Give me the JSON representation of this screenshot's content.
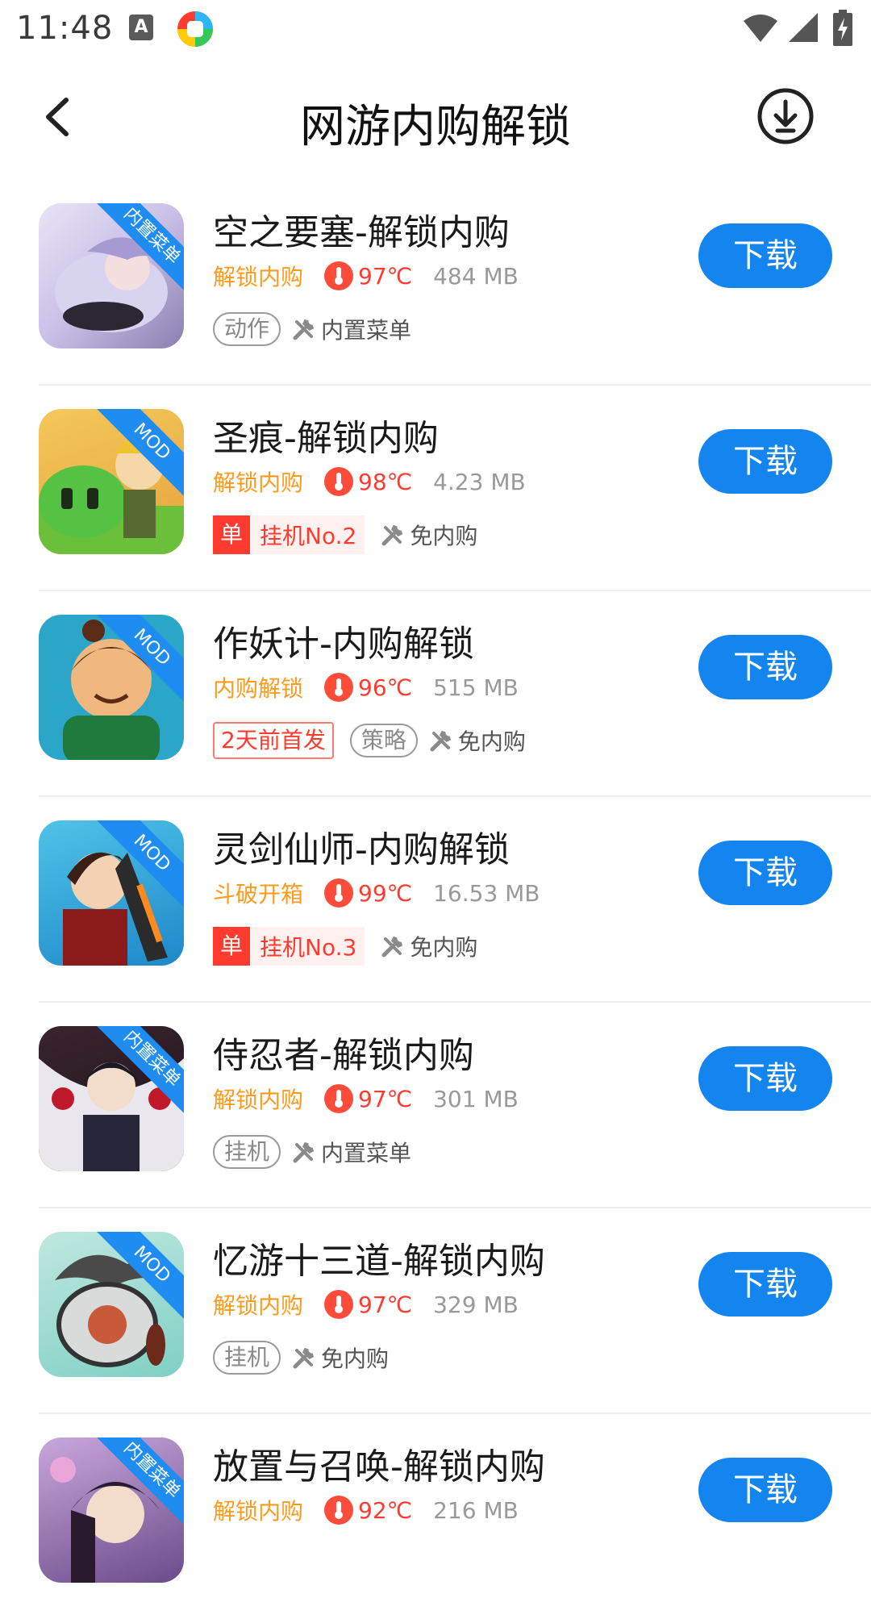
{
  "status": {
    "time": "11:48",
    "a_label": "A"
  },
  "header": {
    "title": "网游内购解锁"
  },
  "colors": {
    "accent": "#1485ee",
    "feature": "#ff9a1e",
    "temperature": "#ff3b30",
    "ribbon": "#1e8cf0"
  },
  "icons": {
    "back": "chevron-left-icon",
    "download_center": "circle-download-icon",
    "temperature": "thermometer-icon",
    "tool": "wrench-icon"
  },
  "games": [
    {
      "title": "空之要塞-解锁内购",
      "feature": "解锁内购",
      "temp": "97℃",
      "size": "484 MB",
      "badge": "内置菜单",
      "tag": "动作",
      "tool_label": "内置菜单",
      "download_label": "下载"
    },
    {
      "title": "圣痕-解锁内购",
      "feature": "解锁内购",
      "temp": "98℃",
      "size": "4.23 MB",
      "badge": "MOD",
      "rank_box": "单",
      "rank_text": "挂机No.2",
      "tool_label": "免内购",
      "download_label": "下载"
    },
    {
      "title": "作妖计-内购解锁",
      "feature": "内购解锁",
      "temp": "96℃",
      "size": "515 MB",
      "badge": "MOD",
      "release": "2天前首发",
      "tag": "策略",
      "tool_label": "免内购",
      "download_label": "下载"
    },
    {
      "title": "灵剑仙师-内购解锁",
      "feature": "斗破开箱",
      "temp": "99℃",
      "size": "16.53 MB",
      "badge": "MOD",
      "rank_box": "单",
      "rank_text": "挂机No.3",
      "tool_label": "免内购",
      "download_label": "下载"
    },
    {
      "title": "侍忍者-解锁内购",
      "feature": "解锁内购",
      "temp": "97℃",
      "size": "301 MB",
      "badge": "内置菜单",
      "tag": "挂机",
      "tool_label": "内置菜单",
      "download_label": "下载"
    },
    {
      "title": "忆游十三道-解锁内购",
      "feature": "解锁内购",
      "temp": "97℃",
      "size": "329 MB",
      "badge": "MOD",
      "tag": "挂机",
      "tool_label": "免内购",
      "download_label": "下载"
    },
    {
      "title": "放置与召唤-解锁内购",
      "feature": "解锁内购",
      "temp": "92℃",
      "size": "216 MB",
      "badge": "内置菜单",
      "download_label": "下载"
    }
  ]
}
